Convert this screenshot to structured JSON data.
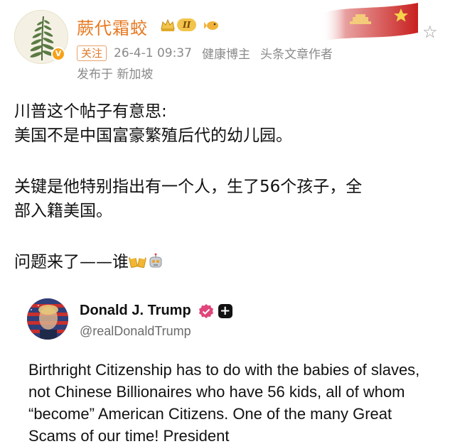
{
  "author": {
    "name": "蕨代霜蛟",
    "rank_badge": "II",
    "follow_label": "关注",
    "timestamp": "26-4-1 09:37",
    "tag_health": "健康博主",
    "tag_writer": "头条文章作者",
    "location": "发布于 新加坡"
  },
  "post": {
    "line1": "川普这个帖子有意思:",
    "line2": "美国不是中国富豪繁殖后代的幼儿园。",
    "line3": "关键是他特别指出有一个人，生了56个孩子，全",
    "line4": "部入籍美国。",
    "line5": "问题来了——谁"
  },
  "tweet": {
    "name": "Donald J. Trump",
    "handle": "@realDonaldTrump",
    "text": "Birthright Citizenship has to do with the babies of slaves, not Chinese Billionaires who have 56 kids, all of whom “become” American Citizens. One of the many Great Scams of our time! President"
  },
  "colors": {
    "username": "#e8781f",
    "meta_gray": "#8a8a8a",
    "verified_pink": "#e0457b"
  },
  "icons": [
    "fern-avatar",
    "verified-v-icon",
    "crown-icon",
    "fish-icon",
    "flag-banner",
    "star-icon",
    "cheers-emoji",
    "robot-emoji",
    "verified-badge-icon",
    "plus-icon"
  ]
}
